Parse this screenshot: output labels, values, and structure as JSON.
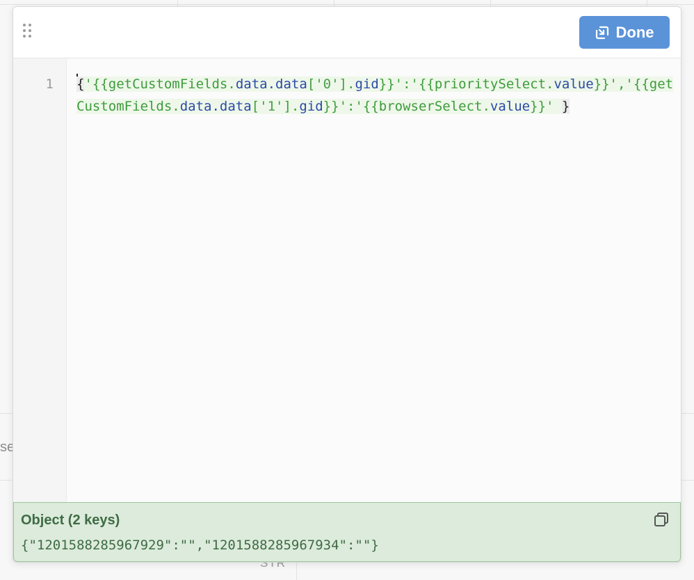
{
  "header": {
    "done_label": "Done"
  },
  "editor": {
    "line_number": "1",
    "tokens": [
      {
        "t": "{",
        "k": "punct"
      },
      {
        "t": "'",
        "k": "str"
      },
      {
        "t": "{{getCustomFields.",
        "k": "tmpl"
      },
      {
        "t": "data.data",
        "k": "prop"
      },
      {
        "t": "['",
        "k": "tmpl"
      },
      {
        "t": "0",
        "k": "num"
      },
      {
        "t": "'].",
        "k": "tmpl"
      },
      {
        "t": "gid",
        "k": "prop"
      },
      {
        "t": "}}",
        "k": "tmpl"
      },
      {
        "t": "':'",
        "k": "str"
      },
      {
        "t": "{{prioritySelect.",
        "k": "tmpl"
      },
      {
        "t": "value",
        "k": "prop"
      },
      {
        "t": "}}",
        "k": "tmpl"
      },
      {
        "t": "','",
        "k": "str"
      },
      {
        "t": "{{getCustomFields.",
        "k": "tmpl"
      },
      {
        "t": "data.data",
        "k": "prop"
      },
      {
        "t": "['",
        "k": "tmpl"
      },
      {
        "t": "1",
        "k": "num"
      },
      {
        "t": "'].",
        "k": "tmpl"
      },
      {
        "t": "gid",
        "k": "prop"
      },
      {
        "t": "}}",
        "k": "tmpl"
      },
      {
        "t": "':'",
        "k": "str"
      },
      {
        "t": "{{browserSelect.",
        "k": "tmpl"
      },
      {
        "t": "value",
        "k": "prop"
      },
      {
        "t": "}}",
        "k": "tmpl"
      },
      {
        "t": "' ",
        "k": "str"
      },
      {
        "t": "}",
        "k": "punct"
      }
    ]
  },
  "preview": {
    "type_label": "Object (2 keys)",
    "value": "{\"1201588285967929\":\"\",\"1201588285967934\":\"\"}"
  },
  "background": {
    "partial_label": "se",
    "column_type": "STR"
  },
  "colors": {
    "done_button": "#5b93d9",
    "preview_bg": "#dcebdc",
    "preview_text": "#3f6b44",
    "string_token": "#3d9c3d",
    "property_token": "#2a4aa8"
  },
  "icons": {
    "drag_handle": "drag-handle-icon",
    "done": "collapse-arrow-icon",
    "copy": "copy-icon"
  }
}
